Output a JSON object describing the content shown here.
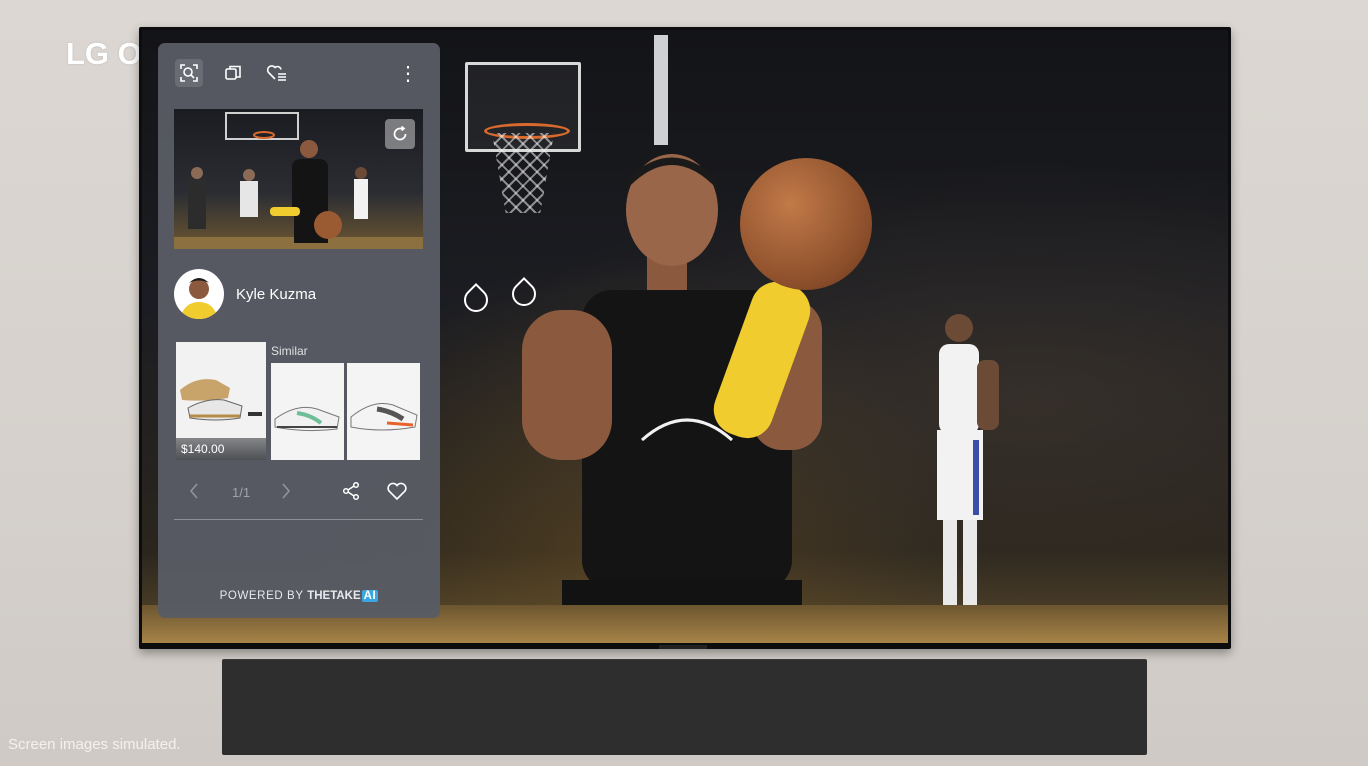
{
  "brand": "LG OLED",
  "disclaimer": "Screen images simulated.",
  "panel": {
    "toolbar": {
      "icons": [
        "search-scene-icon",
        "copy-icon",
        "favorites-list-icon",
        "more-vertical-icon"
      ],
      "more": "⋮"
    },
    "person": {
      "name": "Kyle Kuzma"
    },
    "products": {
      "main_price": "$140.00",
      "similar_label": "Similar"
    },
    "pager": {
      "text": "1/1"
    },
    "powered": {
      "prefix": "POWERED BY",
      "brand": "THETAKE",
      "badge": "AI"
    }
  },
  "colors": {
    "panel": "#585c64",
    "accent": "#3aa7e0",
    "jersey": "#1a1a1a",
    "sleeve": "#f2d233"
  }
}
